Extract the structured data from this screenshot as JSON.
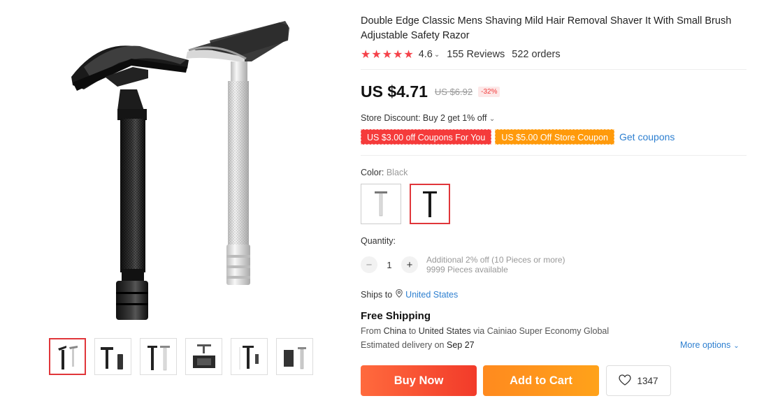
{
  "product": {
    "title": "Double Edge Classic Mens Shaving Mild Hair Removal Shaver It With Small Brush Adjustable Safety Razor",
    "rating": {
      "stars": "★★★★★",
      "score": "4.6",
      "reviews": "155 Reviews",
      "orders": "522 orders"
    },
    "price": {
      "current": "US $4.71",
      "original": "US $6.92",
      "discount": "-32%"
    },
    "store_discount": "Store Discount: Buy 2 get 1% off",
    "coupons": [
      "US $3.00 off Coupons For You",
      "US $5.00 Off Store Coupon"
    ],
    "get_coupons": "Get coupons",
    "color": {
      "label": "Color:",
      "value": "Black",
      "options": [
        "Silver",
        "Black"
      ],
      "selected": 1
    },
    "quantity": {
      "label": "Quantity:",
      "minus": "−",
      "value": "1",
      "plus": "+",
      "note": "Additional 2% off (10 Pieces or more)",
      "available": "9999 Pieces available"
    },
    "shipping": {
      "ships_to_label": "Ships to",
      "country": "United States",
      "title": "Free Shipping",
      "from_prefix": "From",
      "from": "China",
      "to_prefix": "to",
      "to": "United States",
      "via": "via Cainiao Super Economy Global",
      "est_prefix": "Estimated delivery on",
      "est_date": "Sep 27",
      "more_options": "More options"
    },
    "buttons": {
      "buy_now": "Buy Now",
      "add_to_cart": "Add to Cart",
      "wishlist_count": "1347"
    }
  },
  "gallery": {
    "thumbnail_count": 6,
    "active_index": 0
  },
  "colors": {
    "accent_red": "#e0363a",
    "price_red": "#f5424a",
    "link_blue": "#2d7fd0",
    "buy_now": "#f23b2a",
    "add_to_cart": "#ffa21a",
    "coupon_red": "#f53b3b",
    "coupon_orange": "#ff9a0b"
  },
  "icons": {
    "rating": "star-icon",
    "location": "location-pin-icon",
    "wishlist": "heart-icon",
    "dropdown": "chevron-down-icon"
  }
}
